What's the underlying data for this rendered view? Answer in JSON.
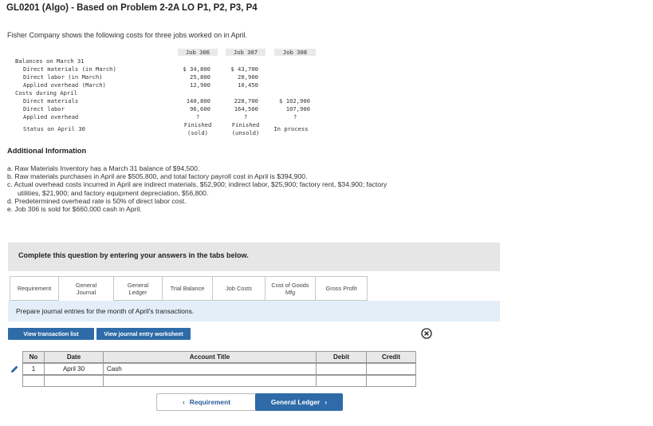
{
  "title": "GL0201 (Algo) - Based on Problem 2-2A LO P1, P2, P3, P4",
  "intro": "Fisher Company shows the following costs for three jobs worked on in April.",
  "cost_table": {
    "jobs": [
      "Job 306",
      "Job 307",
      "Job 308"
    ],
    "section_balances": "Balances on March 31",
    "row_dm_march": {
      "label": "Direct materials (in March)",
      "values": [
        "$ 34,800",
        "$ 43,700",
        ""
      ]
    },
    "row_dl_march": {
      "label": "Direct labor (in March)",
      "values": [
        "25,800",
        "20,900",
        ""
      ]
    },
    "row_oh_march": {
      "label": "Applied overhead (March)",
      "values": [
        "12,900",
        "10,450",
        ""
      ]
    },
    "section_april": "Costs during April",
    "row_dm_april": {
      "label": "Direct materials",
      "values": [
        "140,800",
        "228,700",
        "$ 102,900"
      ]
    },
    "row_dl_april": {
      "label": "Direct labor",
      "values": [
        "96,600",
        "164,500",
        "107,900"
      ]
    },
    "row_oh_april": {
      "label": "Applied overhead",
      "values": [
        "?",
        "?",
        "?"
      ]
    },
    "row_status": {
      "label": "Status on April 30",
      "values": [
        "Finished",
        "Finished",
        "In process"
      ],
      "sub": [
        "(sold)",
        "(unsold)",
        ""
      ]
    }
  },
  "additional": {
    "title": "Additional Information",
    "items": [
      "a. Raw Materials Inventory has a March 31 balance of $94,500.",
      "b. Raw materials purchases in April are $505,800, and total factory payroll cost in April is $394,900.",
      "c. Actual overhead costs incurred in April are indirect materials, $52,900; indirect labor, $25,900; factory rent, $34,900; factory",
      "utilities, $21,900; and factory equipment depreciation, $56,800.",
      "d. Predetermined overhead rate is 50% of direct labor cost.",
      "e. Job 306 is sold for $660,000 cash in April."
    ]
  },
  "complete_text": "Complete this question by entering your answers in the tabs below.",
  "tabs": [
    {
      "line1": "Requirement",
      "line2": ""
    },
    {
      "line1": "General",
      "line2": "Journal"
    },
    {
      "line1": "General",
      "line2": "Ledger"
    },
    {
      "line1": "Trial Balance",
      "line2": ""
    },
    {
      "line1": "Job Costs",
      "line2": ""
    },
    {
      "line1": "Cost of Goods",
      "line2": "Mfg"
    },
    {
      "line1": "Gross Profit",
      "line2": ""
    }
  ],
  "panel_text": "Prepare journal entries for the month of April's transactions.",
  "buttons": {
    "view_list": "View transaction list",
    "view_worksheet": "View journal entry worksheet",
    "prev": "Requirement",
    "next": "General Ledger"
  },
  "journal": {
    "headers": [
      "No",
      "Date",
      "Account Title",
      "Debit",
      "Credit"
    ],
    "rows": [
      {
        "no": "1",
        "date": "April 30",
        "account": "Cash",
        "debit": "",
        "credit": ""
      },
      {
        "no": "",
        "date": "",
        "account": "",
        "debit": "",
        "credit": ""
      }
    ]
  },
  "colors": {
    "accent": "#2e6ba8",
    "panel": "#e3eef8",
    "gray_box": "#e6e6e6"
  }
}
